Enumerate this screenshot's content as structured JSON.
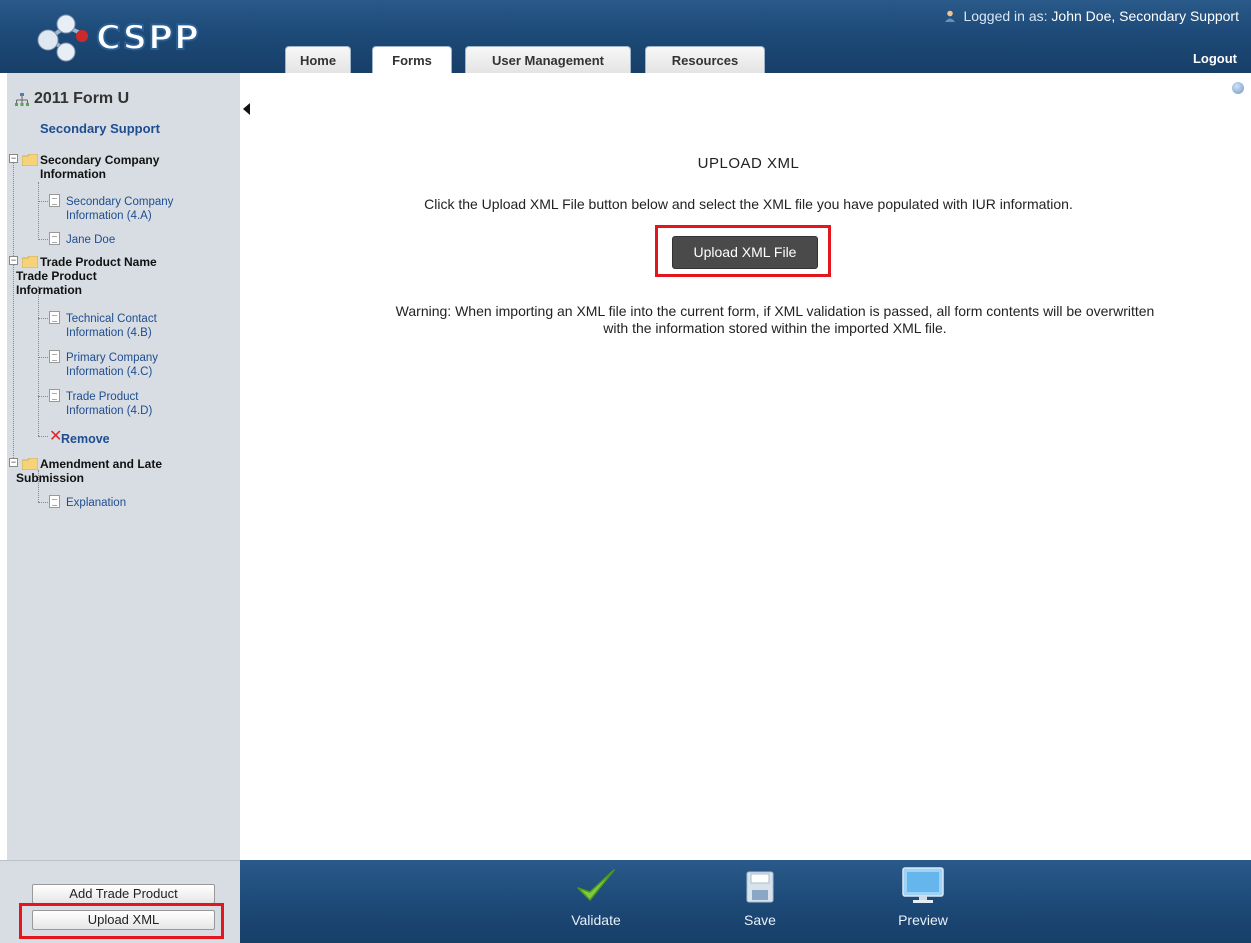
{
  "header": {
    "logo_text": "CSPP",
    "logged_in_prefix": "Logged in as:",
    "user_name": "John Doe, Secondary Support",
    "logout_label": "Logout",
    "tabs": [
      {
        "label": "Home"
      },
      {
        "label": "Forms"
      },
      {
        "label": "User Management"
      },
      {
        "label": "Resources"
      }
    ]
  },
  "sidebar": {
    "form_title": "2011 Form U",
    "subtitle": "Secondary Support",
    "tree": {
      "group1": {
        "label_line1": "Secondary Company",
        "label_line2": "Information"
      },
      "group1_items": [
        {
          "line1": "Secondary Company",
          "line2": "Information (4.A)"
        },
        {
          "line1": "Jane Doe"
        }
      ],
      "group2": {
        "label_line1": "Trade Product Name",
        "label_line2": "Trade Product",
        "label_line3": "Information"
      },
      "group2_items": [
        {
          "line1": "Technical Contact",
          "line2": "Information (4.B)"
        },
        {
          "line1": "Primary Company",
          "line2": "Information (4.C)"
        },
        {
          "line1": "Trade Product",
          "line2": "Information (4.D)"
        }
      ],
      "remove_label": "Remove",
      "group3": {
        "label_line1": "Amendment and Late",
        "label_line2": "Submission"
      },
      "group3_items": [
        {
          "line1": "Explanation"
        }
      ]
    },
    "buttons": {
      "add_trade_product": "Add Trade Product",
      "upload_xml": "Upload XML"
    }
  },
  "main": {
    "heading": "UPLOAD XML",
    "instructions": "Click the Upload XML File button below and select the XML file you have populated with IUR information.",
    "upload_button": "Upload XML File",
    "warning_line1": "Warning: When importing an XML file into the current form, if XML validation is passed, all form contents will be overwritten",
    "warning_line2": "with the information stored within the imported XML file."
  },
  "footer": {
    "tools": [
      {
        "label": "Validate",
        "icon": "checkmark-icon"
      },
      {
        "label": "Save",
        "icon": "floppy-disk-icon"
      },
      {
        "label": "Preview",
        "icon": "monitor-icon"
      }
    ]
  },
  "colors": {
    "header_blue": "#1d4a78",
    "sidebar_gray": "#d7dde3",
    "link_blue": "#1f4d8f",
    "highlight_red": "#e4151c",
    "remove_red": "#e0242b"
  }
}
